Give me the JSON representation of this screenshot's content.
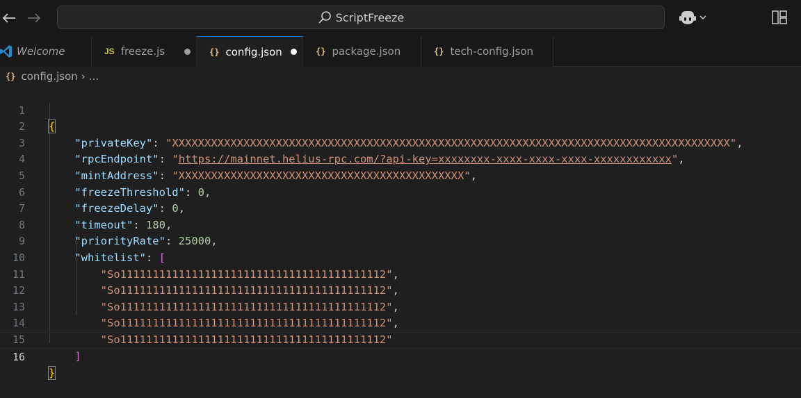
{
  "titlebar": {
    "search_text": "ScriptFreeze",
    "back_icon": "arrow-left-icon",
    "forward_icon": "arrow-right-icon",
    "search_icon": "search-icon",
    "copilot_icon": "copilot-icon",
    "layout_icon": "layout-icon"
  },
  "tabs": [
    {
      "label": "Welcome",
      "icon": "vscode-logo-icon",
      "active": false,
      "dirty": false
    },
    {
      "label": "freeze.js",
      "icon_text": "JS",
      "active": false,
      "dirty": true
    },
    {
      "label": "config.json",
      "icon_text": "{}",
      "active": true,
      "dirty": true
    },
    {
      "label": "package.json",
      "icon_text": "{}",
      "active": false,
      "dirty": false
    },
    {
      "label": "tech-config.json",
      "icon_text": "{}",
      "active": false,
      "dirty": false
    }
  ],
  "breadcrumb": {
    "icon_text": "{}",
    "file": "config.json",
    "more": "..."
  },
  "editor": {
    "line_numbers": [
      "1",
      "2",
      "3",
      "4",
      "5",
      "6",
      "7",
      "8",
      "9",
      "10",
      "11",
      "12",
      "13",
      "14",
      "15",
      "16"
    ],
    "current_line": 16,
    "keys": {
      "privateKey": "\"privateKey\"",
      "rpcEndpoint": "\"rpcEndpoint\"",
      "mintAddress": "\"mintAddress\"",
      "freezeThreshold": "\"freezeThreshold\"",
      "freezeDelay": "\"freezeDelay\"",
      "timeout": "\"timeout\"",
      "priorityRate": "\"priorityRate\"",
      "whitelist": "\"whitelist\""
    },
    "values": {
      "privateKey": "XXXXXXXXXXXXXXXXXXXXXXXXXXXXXXXXXXXXXXXXXXXXXXXXXXXXXXXXXXXXXXXXXXXXXXXXXXXXXXXXXXXXXX",
      "rpcEndpoint": "https://mainnet.helius-rpc.com/?api-key=xxxxxxxx-xxxx-xxxx-xxxx-xxxxxxxxxxxx",
      "mintAddress": "XXXXXXXXXXXXXXXXXXXXXXXXXXXXXXXXXXXXXXXXXXXX",
      "freezeThreshold": "0",
      "freezeDelay": "0",
      "timeout": "180",
      "priorityRate": "25000",
      "whitelist": [
        "So11111111111111111111111111111111111111112",
        "So11111111111111111111111111111111111111112",
        "So11111111111111111111111111111111111111112",
        "So11111111111111111111111111111111111111112",
        "So11111111111111111111111111111111111111112"
      ]
    }
  },
  "colors": {
    "accent": "#0078d4",
    "key": "#9cdcfe",
    "string": "#ce9178",
    "number": "#b5cea8",
    "bracket_level1": "#ffd700",
    "bracket_level2": "#da70d6",
    "json_icon": "#e2c08d",
    "js_icon": "#cbcb41"
  }
}
